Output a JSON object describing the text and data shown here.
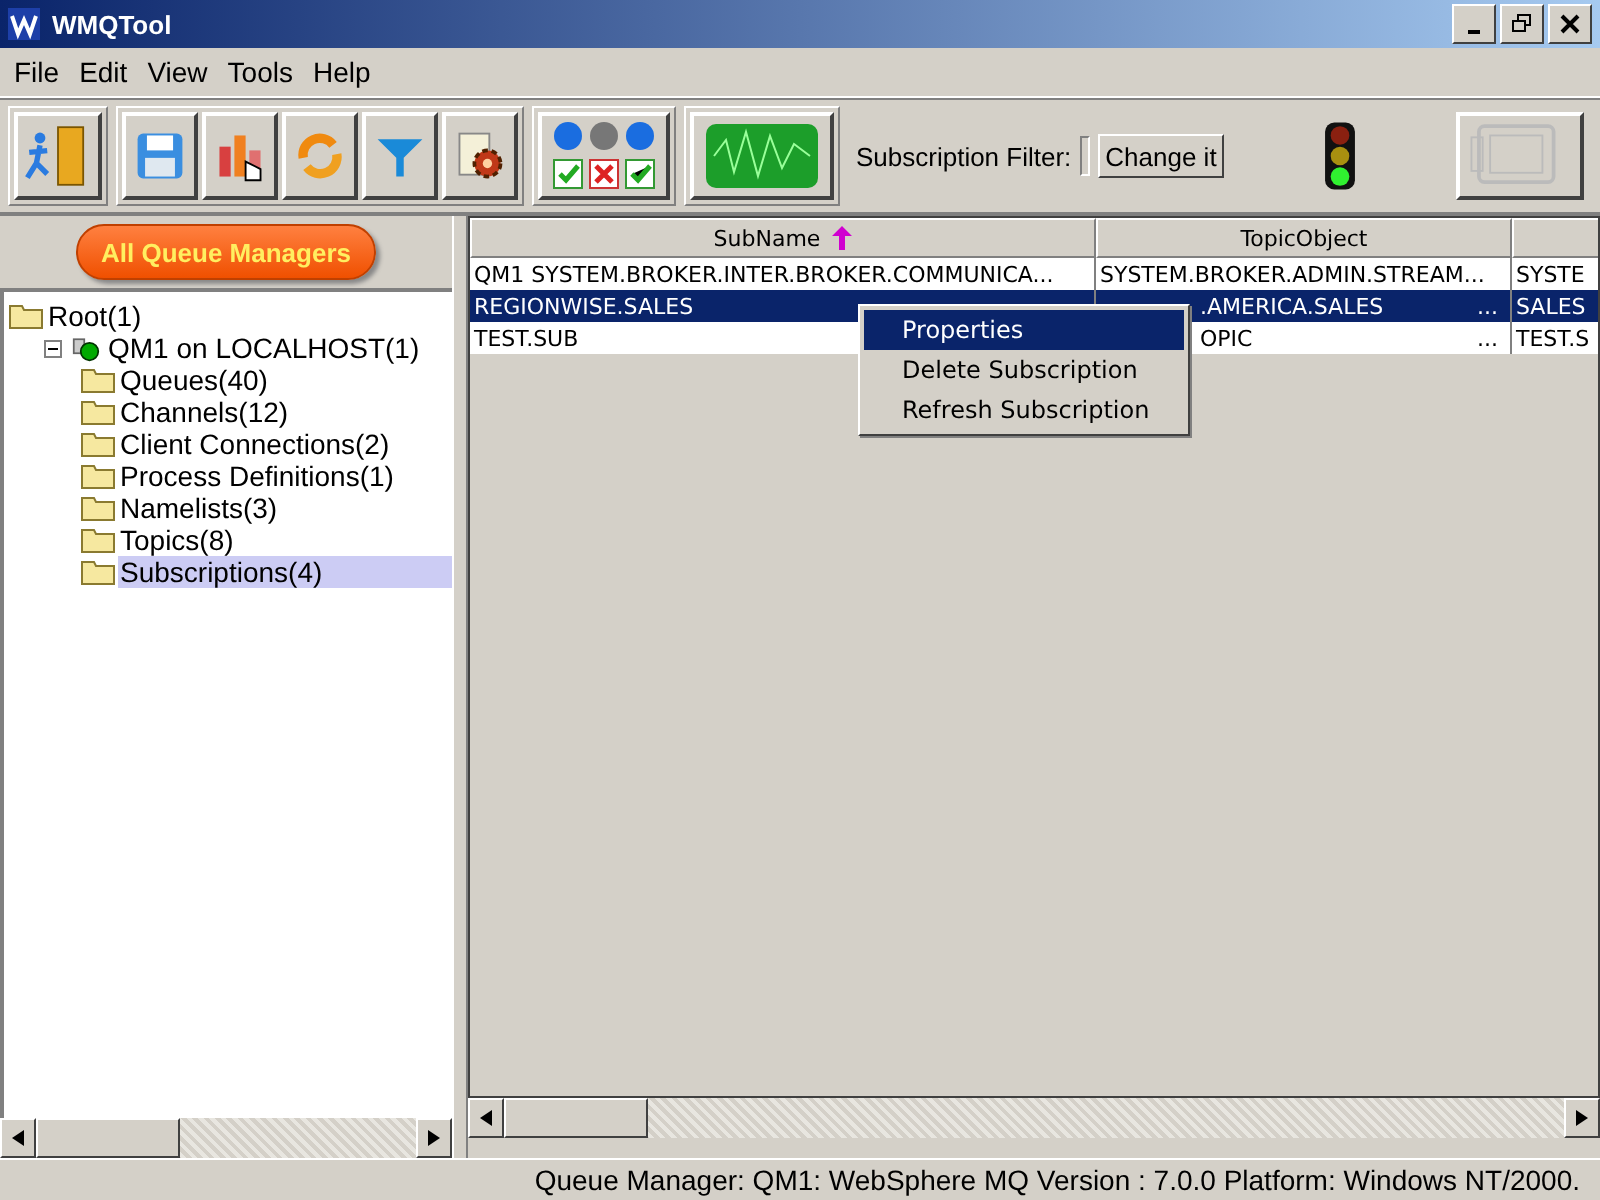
{
  "window": {
    "title": "WMQTool"
  },
  "menu": [
    "File",
    "Edit",
    "View",
    "Tools",
    "Help"
  ],
  "toolbar": {
    "filter_label": "Subscription Filter:",
    "filter_button": "Change it"
  },
  "left_panel": {
    "button": "All Queue Managers",
    "tree": [
      {
        "label": "Root(1)",
        "kind": "folder",
        "selected": false,
        "children": [
          {
            "label": "QM1 on LOCALHOST(1)",
            "kind": "manager",
            "expanded": true,
            "selected": false,
            "children": [
              {
                "label": "Queues(40)",
                "kind": "folder",
                "selected": false
              },
              {
                "label": "Channels(12)",
                "kind": "folder",
                "selected": false
              },
              {
                "label": "Client Connections(2)",
                "kind": "folder",
                "selected": false
              },
              {
                "label": "Process Definitions(1)",
                "kind": "folder",
                "selected": false
              },
              {
                "label": "Namelists(3)",
                "kind": "folder",
                "selected": false
              },
              {
                "label": "Topics(8)",
                "kind": "folder",
                "selected": false
              },
              {
                "label": "Subscriptions(4)",
                "kind": "folder",
                "selected": true
              }
            ]
          }
        ]
      }
    ]
  },
  "table": {
    "columns": [
      {
        "label": "SubName",
        "sorted": true
      },
      {
        "label": "TopicObject",
        "sorted": false
      },
      {
        "sorted": false
      }
    ],
    "rows": [
      {
        "selected": false,
        "cells": [
          {
            "text": "QM1 SYSTEM.BROKER.INTER.BROKER.COMMUNICA..."
          },
          {
            "text": "SYSTEM.BROKER.ADMIN.STREAM..."
          },
          {
            "text": "SYSTE"
          }
        ]
      },
      {
        "selected": true,
        "cells": [
          {
            "text": "REGIONWISE.SALES"
          },
          {
            "text": ".AMERICA.SALES",
            "more": "..."
          },
          {
            "text": "SALES"
          }
        ]
      },
      {
        "selected": false,
        "cells": [
          {
            "text": "TEST.SUB"
          },
          {
            "text": "OPIC",
            "more": "..."
          },
          {
            "text": "TEST.S"
          }
        ]
      }
    ]
  },
  "context_menu": [
    {
      "label": "Properties",
      "selected": true
    },
    {
      "label": "Delete Subscription",
      "selected": false
    },
    {
      "label": "Refresh Subscription",
      "selected": false
    }
  ],
  "status_bar": "Queue Manager: QM1: WebSphere MQ Version : 7.0.0 Platform: Windows NT/2000."
}
